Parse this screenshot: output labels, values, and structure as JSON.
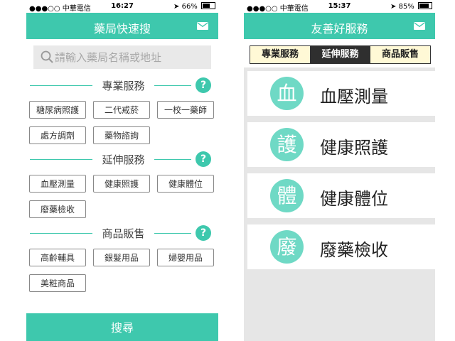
{
  "left": {
    "status": {
      "carrier": "●●●○○ 中華電信",
      "time": "16:27",
      "battery": "66%",
      "battery_level": 0.66
    },
    "nav": {
      "title": "藥局快速搜",
      "icon": "mail-icon"
    },
    "search": {
      "placeholder": "請輸入藥局名稱或地址",
      "icon": "search-icon"
    },
    "sections": [
      {
        "title": "專業服務",
        "help": "?",
        "chips": [
          "糖尿病照護",
          "二代戒菸",
          "一校一藥師",
          "處方調劑",
          "藥物諮詢"
        ]
      },
      {
        "title": "延伸服務",
        "help": "?",
        "chips": [
          "血壓測量",
          "健康照護",
          "健康體位",
          "廢藥檢收"
        ]
      },
      {
        "title": "商品販售",
        "help": "?",
        "chips": [
          "高齡輔具",
          "銀髮用品",
          "婦嬰用品",
          "美粧商品"
        ]
      }
    ],
    "submit_label": "搜尋"
  },
  "right": {
    "status": {
      "carrier": "●●●○○ 中華電信",
      "time": "15:37",
      "battery": "85%",
      "battery_level": 0.85
    },
    "nav": {
      "title": "友善好服務",
      "icon": "mail-icon"
    },
    "tabs": [
      {
        "label": "專業服務",
        "selected": false
      },
      {
        "label": "延伸服務",
        "selected": true
      },
      {
        "label": "商品販售",
        "selected": false
      }
    ],
    "services": [
      {
        "glyph": "血",
        "label": "血壓測量"
      },
      {
        "glyph": "護",
        "label": "健康照護"
      },
      {
        "glyph": "體",
        "label": "健康體位"
      },
      {
        "glyph": "廢",
        "label": "廢藥檢收"
      }
    ]
  },
  "colors": {
    "accent": "#3ec8ad",
    "circle": "#6fd9c5",
    "tab_selected": "#2f2f2f",
    "tab_unselected": "#fff9d6"
  }
}
